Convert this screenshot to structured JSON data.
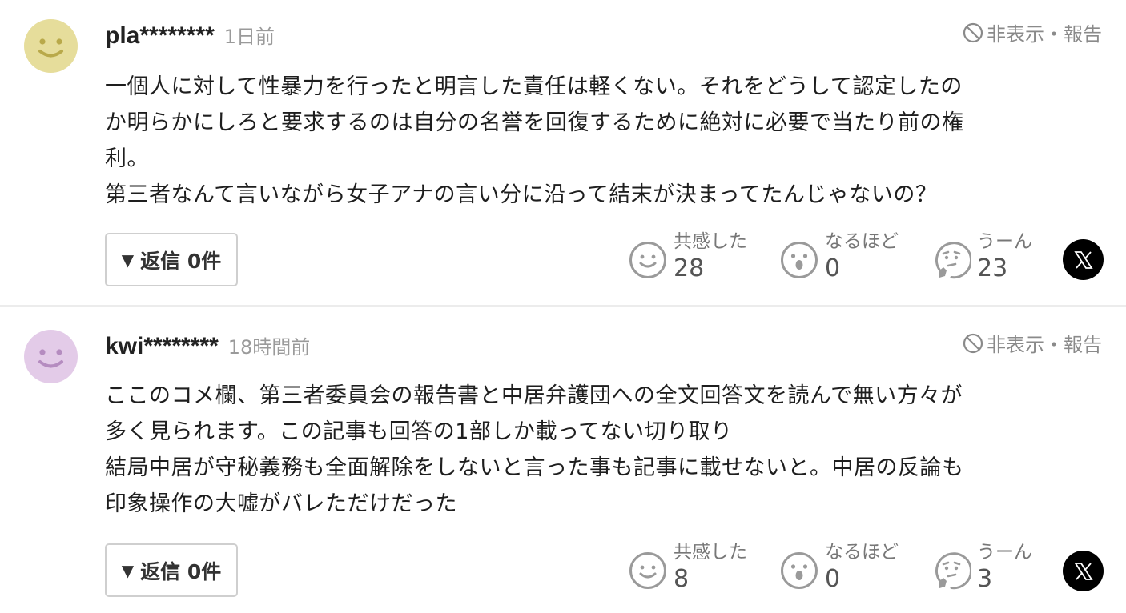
{
  "comments": [
    {
      "avatar_color": "#e6dd9b",
      "avatar_icon": "smiley-face",
      "username": "pla********",
      "time": "1日前",
      "hide_report": "非表示・報告",
      "text": "一個人に対して性暴力を行ったと明言した責任は軽くない。それをどうして認定したの\nか明らかにしろと要求するのは自分の名誉を回復するために絶対に必要で当たり前の権\n利。\n第三者なんて言いながら女子アナの言い分に沿って結末が決まってたんじゃないの？",
      "reply_label": "返信 0件",
      "reactions": [
        {
          "label": "共感した",
          "count": "28",
          "icon": "smile-icon"
        },
        {
          "label": "なるほど",
          "count": "0",
          "icon": "surprised-icon"
        },
        {
          "label": "うーん",
          "count": "23",
          "icon": "thinking-icon"
        }
      ],
      "share_icon": "x-logo"
    },
    {
      "avatar_color": "#e3cbe8",
      "avatar_icon": "smiley-face",
      "username": "kwi********",
      "time": "18時間前",
      "hide_report": "非表示・報告",
      "text": "ここのコメ欄、第三者委員会の報告書と中居弁護団への全文回答文を読んで無い方々が\n多く見られます。この記事も回答の1部しか載ってない切り取り\n結局中居が守秘義務も全面解除をしないと言った事も記事に載せないと。中居の反論も\n印象操作の大嘘がバレただけだった",
      "reply_label": "返信 0件",
      "reactions": [
        {
          "label": "共感した",
          "count": "8",
          "icon": "smile-icon"
        },
        {
          "label": "なるほど",
          "count": "0",
          "icon": "surprised-icon"
        },
        {
          "label": "うーん",
          "count": "3",
          "icon": "thinking-icon"
        }
      ],
      "share_icon": "x-logo"
    }
  ],
  "colors": {
    "face_yellow": "#e6dd9b",
    "face_purple": "#e3cbe8",
    "face_feature_yellow": "#b9a94a",
    "face_feature_purple": "#b58cc0",
    "reaction_gray": "#9a9a9a"
  }
}
